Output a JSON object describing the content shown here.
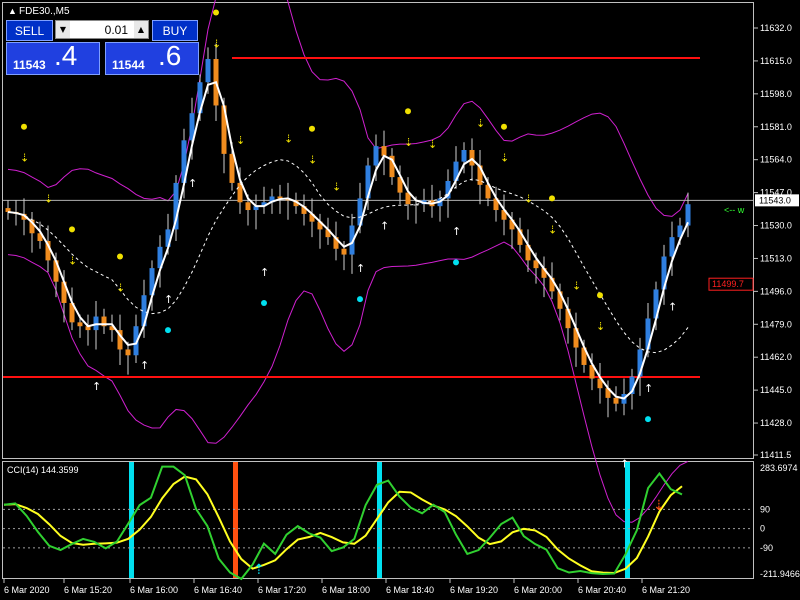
{
  "window": {
    "title": "FDE30.,M5"
  },
  "trade_panel": {
    "sell_label": "SELL",
    "buy_label": "BUY",
    "lot_size": "0.01",
    "sell_price_small": "11543",
    "sell_price_big": ".4",
    "buy_price_small": "11544",
    "buy_price_big": ".6"
  },
  "main_axis": {
    "ticks": [
      "11632.0",
      "11615.0",
      "11598.0",
      "11581.0",
      "11564.0",
      "11547.0",
      "11530.0",
      "11513.0",
      "11496.0",
      "11479.0",
      "11462.0",
      "11445.0",
      "11428.0",
      "11411.5"
    ],
    "current_price": "11543.0",
    "red_label": "11499.7"
  },
  "right_edge_text": "<-- w",
  "indicator": {
    "label": "CCI(14) 144.3599",
    "ticks": [
      "283.6974",
      "90",
      "0",
      "-90",
      "-211.9466"
    ]
  },
  "time_axis": [
    "6 Mar 2020",
    "6 Mar 15:20",
    "6 Mar 16:00",
    "6 Mar 16:40",
    "6 Mar 17:20",
    "6 Mar 18:00",
    "6 Mar 18:40",
    "6 Mar 19:20",
    "6 Mar 20:00",
    "6 Mar 20:40",
    "6 Mar 21:20"
  ],
  "colors": {
    "bull": "#2f7fe0",
    "bear": "#f08c1e",
    "neutral": "#a0a0a0",
    "band": "#d020d0",
    "level": "#ff1010",
    "cyan": "#00e0f0",
    "yellow": "#f0e000",
    "cci_green": "#30d030",
    "cci_yellow": "#ffff20"
  },
  "chart_data": {
    "type": "candlestick",
    "close_series": [
      11537,
      11536,
      11533,
      11526,
      11522,
      11512,
      11501,
      11490,
      11480,
      11478,
      11476,
      11483,
      11478,
      11476,
      11466,
      11463,
      11478,
      11494,
      11508,
      11519,
      11528,
      11552,
      11574,
      11588,
      11604,
      11616,
      11592,
      11567,
      11552,
      11542,
      11538,
      11540,
      11542,
      11545,
      11544,
      11543,
      11540,
      11536,
      11532,
      11528,
      11524,
      11518,
      11515,
      11530,
      11544,
      11561,
      11571,
      11566,
      11555,
      11547,
      11541,
      11541,
      11543,
      11540,
      11544,
      11553,
      11563,
      11569,
      11561,
      11551,
      11544,
      11538,
      11533,
      11528,
      11520,
      11512,
      11508,
      11503,
      11496,
      11487,
      11477,
      11467,
      11458,
      11451,
      11446,
      11441,
      11438,
      11443,
      11452,
      11466,
      11482,
      11497,
      11514,
      11524,
      11530,
      11541
    ],
    "cci_values": [
      112,
      118,
      60,
      -15,
      -80,
      -100,
      -72,
      -48,
      -62,
      -92,
      -60,
      24,
      110,
      145,
      290,
      290,
      250,
      92,
      12,
      -140,
      -205,
      -235,
      -168,
      -70,
      -118,
      -28,
      12,
      -22,
      -42,
      -105,
      -88,
      -48,
      110,
      205,
      225,
      150,
      98,
      72,
      112,
      78,
      -28,
      -118,
      -100,
      -42,
      22,
      52,
      -35,
      -72,
      -98,
      -185,
      -205,
      -198,
      -208,
      -212,
      -210,
      -120,
      -8,
      190,
      258,
      185,
      160
    ]
  }
}
